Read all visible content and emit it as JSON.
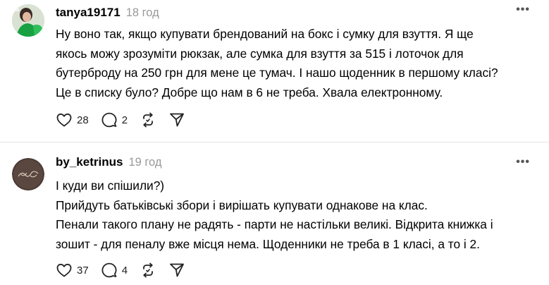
{
  "comments": [
    {
      "username": "tanya19171",
      "time": "18 год",
      "lines": [
        "Ну воно так, якщо купувати брендований на бокс і сумку для взуття. Я ще",
        "якось можу зрозуміти рюкзак, але сумка для взуття за 515 і лоточок для",
        "бутерброду на 250 грн для мене це тумач. І нашо щоденник в першому класі?",
        "Це в списку було? Добре що нам в 6 не треба. Хвала електронному."
      ],
      "likes": "28",
      "replies": "2"
    },
    {
      "username": "by_ketrinus",
      "time": "19 год",
      "lines": [
        "І куди ви спішили?)",
        "Прийдуть батьківські збори і вирішать купувати однакове на клас.",
        "Пенали такого плану не радять - парти не настільки великі. Відкрита книжка і",
        "зошит - для пеналу вже місця нема. Щоденники не треба в 1 класі, а то і 2."
      ],
      "likes": "37",
      "replies": "4"
    }
  ],
  "icons": {
    "more": "more-icon",
    "like": "heart-icon",
    "reply": "comment-icon",
    "repost": "repost-icon",
    "share": "send-icon"
  },
  "colors": {
    "timestamp": "#999999",
    "divider": "#e2e2e2",
    "icon": "#222222"
  }
}
